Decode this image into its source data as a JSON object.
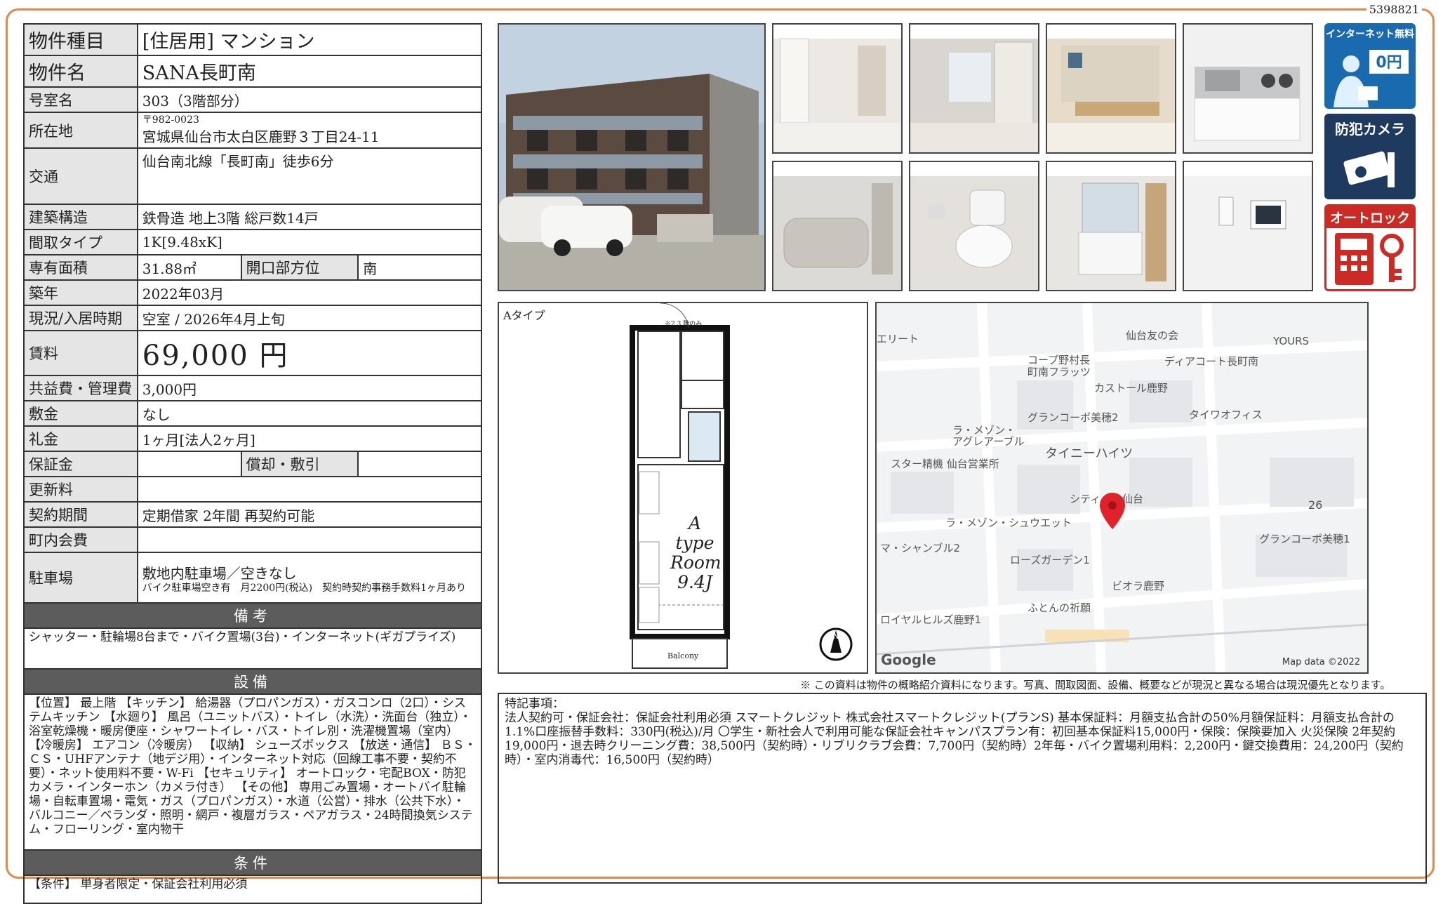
{
  "doc_id": "5398821",
  "rows": {
    "type_label": "物件種目",
    "type_value": "[住居用] マンション",
    "name_label": "物件名",
    "name_value": "SANA長町南",
    "room_label": "号室名",
    "room_value": "303（3階部分）",
    "addr_label": "所在地",
    "addr_zip": "〒982-0023",
    "addr_value": "宮城県仙台市太白区鹿野３丁目24-11",
    "transit_label": "交通",
    "transit_value": "仙台南北線「長町南」徒歩6分",
    "struct_label": "建築構造",
    "struct_value": "鉄骨造 地上3階 総戸数14戸",
    "layout_label": "間取タイプ",
    "layout_value": "1K[9.48xK]",
    "area_label": "専有面積",
    "area_value": "31.88㎡",
    "dir_label": "開口部方位",
    "dir_value": "南",
    "built_label": "築年",
    "built_value": "2022年03月",
    "status_label": "現況/入居時期",
    "status_value": "空室 / 2026年4月上旬",
    "rent_label": "賃料",
    "rent_value": "69,000 円",
    "fee_label": "共益費・管理費",
    "fee_value": "3,000円",
    "deposit_label": "敷金",
    "deposit_value": "なし",
    "key_label": "礼金",
    "key_value": "1ヶ月[法人2ヶ月]",
    "guar_label": "保証金",
    "guar_value": "",
    "amort_label": "償却・敷引",
    "amort_value": "",
    "renew_label": "更新料",
    "renew_value": "",
    "contract_label": "契約期間",
    "contract_value": "定期借家 2年間 再契約可能",
    "assoc_label": "町内会費",
    "assoc_value": "",
    "parking_label": "駐車場",
    "parking_value": "敷地内駐車場／空きなし",
    "parking_note": "バイク駐車場空き有　月2200円(税込)　契約時契約事務手数料1ヶ月あり"
  },
  "remarks": {
    "title": "備考",
    "body": "シャッター・駐輪場8台まで・バイク置場(3台)・インターネット(ギガプライズ)"
  },
  "equipment": {
    "title": "設備",
    "body": "【位置】 最上階 【キッチン】 給湯器（プロパンガス）・ガスコンロ（2口）・システムキッチン 【水廻り】 風呂（ユニットバス）・トイレ（水洗）・洗面台（独立）・浴室乾燥機・暖房便座・シャワートイレ・バス・トイレ別・洗濯機置場（室内） 【冷暖房】 エアコン（冷暖房） 【収納】 シューズボックス 【放送・通信】 ＢＳ・ＣＳ・UHFアンテナ（地デジ用）・インターネット対応（回線工事不要・契約不要）・ネット使用料不要・W-Fi 【セキュリティ】 オートロック・宅配BOX・防犯カメラ・インターホン（カメラ付き） 【その他】 専用ごみ置場・オートバイ駐輪場・自転車置場・電気・ガス（プロパンガス）・水道（公営）・排水（公共下水）・バルコニー／ベランダ・照明・網戸・複層ガラス・ペアガラス・24時間換気システム・フローリング・室内物干"
  },
  "conditions": {
    "title": "条件",
    "body": "【条件】 単身者限定・保証会社利用必須"
  },
  "badges": {
    "internet": "インターネット無料",
    "internet_price": "0円",
    "camera": "防犯カメラ",
    "autolock": "オートロック"
  },
  "floorplan": {
    "type_label": "Aタイプ",
    "room_line1": "A type",
    "room_line2": "Room",
    "room_line3": "9.4J",
    "balcony": "Balcony",
    "note": "※2,3 階のみ"
  },
  "map": {
    "labels": [
      "エリート",
      "仙台友の会",
      "YOURS",
      "コープ野村長",
      "町南フラッツ",
      "ディアコート長町南",
      "カストール鹿野",
      "グランコーポ美穂2",
      "タイワオフィス",
      "ラ・メゾン・",
      "アグレアーブル",
      "タイニーハイツ",
      "スター精機 仙台営業所",
      "シティ",
      "仙台",
      "26",
      "ラ・メゾン・シュウエット",
      "グランコーポ美穂1",
      "マ・シャンブル2",
      "ローズガーデン1",
      "ビオラ鹿野",
      "ふとんの祈願",
      "ロイヤルヒルズ鹿野1"
    ],
    "google": "Google",
    "mapdata": "Map data ©2022"
  },
  "disclaimer": "※ この資料は物件の概略紹介資料になります。写真、間取図面、設備、概要などが現況と異なる場合は現況優先となります。",
  "special": {
    "title": "特記事項：",
    "body": "法人契約可・保証会社：保証会社利用必須 スマートクレジット 株式会社スマートクレジット(プランS) 基本保証料：月額支払合計の50%月額保証料：月額支払合計の1.1%口座振替手数料：330円(税込)/月 〇学生・新社会人で利用可能な保証会社キャンパスプラン有：初回基本保証料15,000円・保険：保険要加入 火災保険 2年契約 19,000円・退去時クリーニング費：38,500円（契約時）・リブリクラブ会費：7,700円（契約時）2年毎・バイク置場利用料：2,200円・鍵交換費用：24,200円（契約時）・室内消毒代：16,500円（契約時）"
  },
  "colors": {
    "frame": "#e8874a",
    "header": "#5c5c5c",
    "label_bg": "#e5e5e5",
    "badge_blue": "#1a6ab0",
    "badge_navy": "#1f3a5f",
    "badge_red": "#cc2a24",
    "pin": "#e0232b"
  }
}
